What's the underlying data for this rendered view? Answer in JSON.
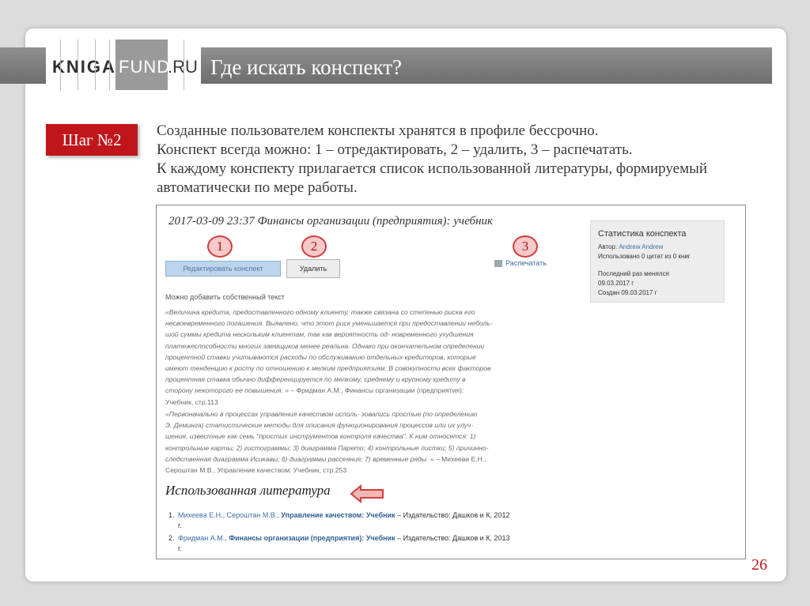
{
  "header": {
    "logo_k": "KNIGA",
    "logo_fund": "FUND",
    "logo_ru": ".RU",
    "title": "Где искать конспект?"
  },
  "step": {
    "label": "Шаг №2"
  },
  "description": [
    "Созданные пользователем конспекты хранятся в профиле бессрочно.",
    "Конспект всегда можно: 1 – отредактировать, 2 – удалить, 3 – распечатать.",
    "К каждому конспекту прилагается список использованной литературы, формируемый",
    "автоматически по мере работы."
  ],
  "screenshot": {
    "note_title": "2017-03-09 23:37 Финансы организации (предприятия): учебник",
    "buttons": {
      "edit": "Редактировать конспект",
      "delete": "Удалить",
      "print": "Распечатать"
    },
    "markers": [
      "1",
      "2",
      "3"
    ],
    "stats": {
      "title": "Статистика конспекта",
      "author_label": "Автор:",
      "author": "Andrew Andrew",
      "used": "Использовано 0 цитат из 0 книг",
      "last_changed_label": "Последний раз менялся",
      "last_changed": "09.03.2017 г",
      "created": "Создан 09.03.2017 г"
    },
    "add_own_text": "Можно добавить собственный текст",
    "quotes": [
      {
        "lines": [
          "«Величина кредита, предоставленного одному клиенту, также связана со степенью риска его",
          "несвоевременного погашения. Выявлено, что этот риск уменьшается при предоставлении неболь-",
          "шой суммы кредита нескольким клиентам, так как вероятность од- новременного ухудшения",
          "платежеспособности многих заемщиков менее реальна. Однако при окончательном определении",
          "процентной ставки учитываются расходы по обслуживанию отдельных кредиторов, которые",
          "имеют тенденцию к росту по отношению к мелким предприятиям. В совокупности всех факторов",
          "процентная ставка обычно дифференцируется по мелкому, среднему и крупному кредиту в",
          "сторону некоторого ее повышения. »"
        ],
        "attribution": " – Фридман А.М., Финансы организации (предприятия):",
        "source": "Учебник, стр.113"
      },
      {
        "lines": [
          "«Первоначально в процессах управления качеством исполь- зовались простые (по определению",
          "Э. Деминга) статистические методы для описания функционирования процессов или их улуч-",
          "шения, известные как семь \"простых инструментов контроля качества\". К ним относятся: 1)",
          "контрольные карты; 2) гистограммы; 3) диаграмма Парето; 4) контрольные листки; 5) причинно-",
          "следственная диаграмма Исикавы; 6) диаграммы рассеяния; 7) временные ряды. »"
        ],
        "attribution": " – Михеева Е.Н.,",
        "source": "Сероштан М.В., Управление качеством: Учебник, стр.253"
      }
    ],
    "literature_heading": "Использованная литература",
    "references": [
      {
        "num": "1.",
        "authors": "Михеева Е.Н., Сероштан М.В.,",
        "book": "Управление качеством: Учебник",
        "pub": " – Издательство: Дашков и К, 2012",
        "year_suffix": "г."
      },
      {
        "num": "2.",
        "authors": "Фридман А.М.,",
        "book": "Финансы организации (предприятия): Учебник",
        "pub": " – Издательство: Дашков и К, 2013",
        "year_suffix": "г."
      }
    ]
  },
  "page_number": "26",
  "colors": {
    "accent": "#c0161b",
    "banner": "#7d7d7d",
    "link": "#3a6ea5"
  }
}
